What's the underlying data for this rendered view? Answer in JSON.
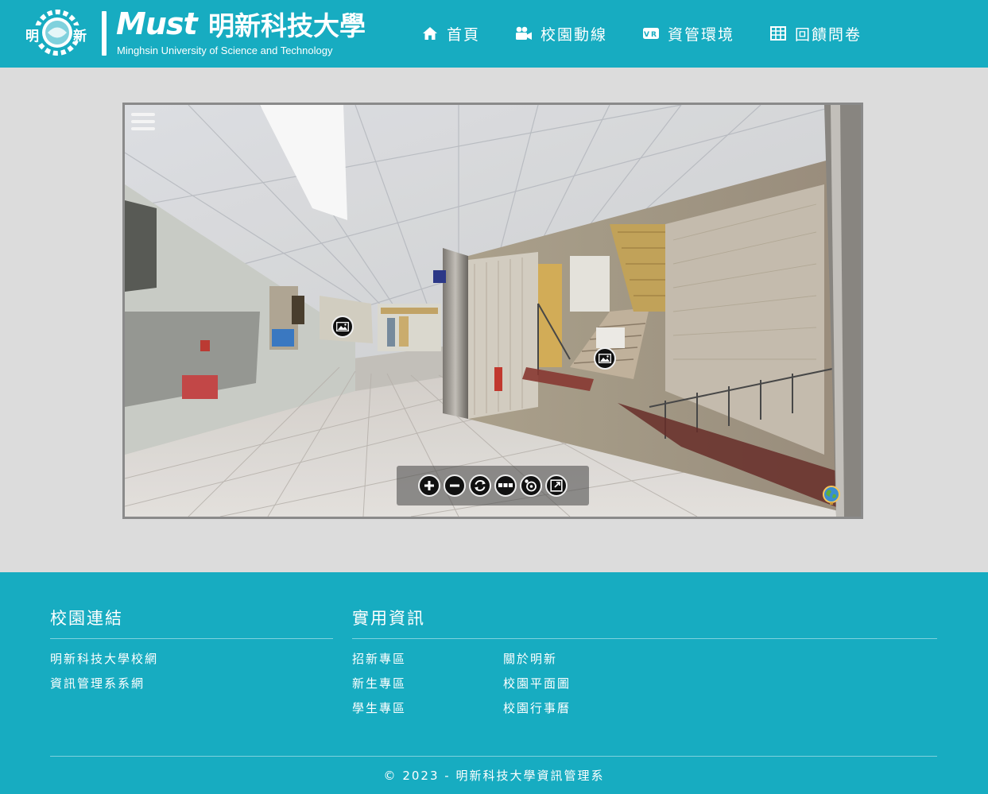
{
  "header": {
    "logo_seal_left": "明",
    "logo_seal_right": "新",
    "logo_wordmark": "Must",
    "logo_chinese": "明新科技大學",
    "logo_english": "Minghsin University of Science and Technology",
    "nav": [
      {
        "label": "首頁",
        "icon": "home-icon"
      },
      {
        "label": "校園動線",
        "icon": "video-camera-icon"
      },
      {
        "label": "資管環境",
        "icon": "vr-icon"
      },
      {
        "label": "回饋問卷",
        "icon": "table-icon"
      }
    ]
  },
  "viewer": {
    "menu_icon": "hamburger-icon",
    "hotspots": [
      "image-hotspot-icon",
      "image-hotspot-icon"
    ],
    "controls": [
      "zoom-in-icon",
      "zoom-out-icon",
      "autorotate-icon",
      "more-icon",
      "gyro-icon",
      "fullscreen-icon"
    ],
    "map_icon": "globe-icon"
  },
  "footer": {
    "campus_links": {
      "heading": "校園連結",
      "links": [
        "明新科技大學校網",
        "資訊管理系系網"
      ]
    },
    "useful_info": {
      "heading": "實用資訊",
      "col1": [
        "招新專區",
        "新生專區",
        "學生專區"
      ],
      "col2": [
        "關於明新",
        "校園平面圖",
        "校園行事曆"
      ]
    },
    "copyright": "© 2023 - 明新科技大學資訊管理系"
  },
  "colors": {
    "brand": "#17acc1",
    "page_bg": "#dcdcdc",
    "text_on_brand": "#ffffff"
  }
}
